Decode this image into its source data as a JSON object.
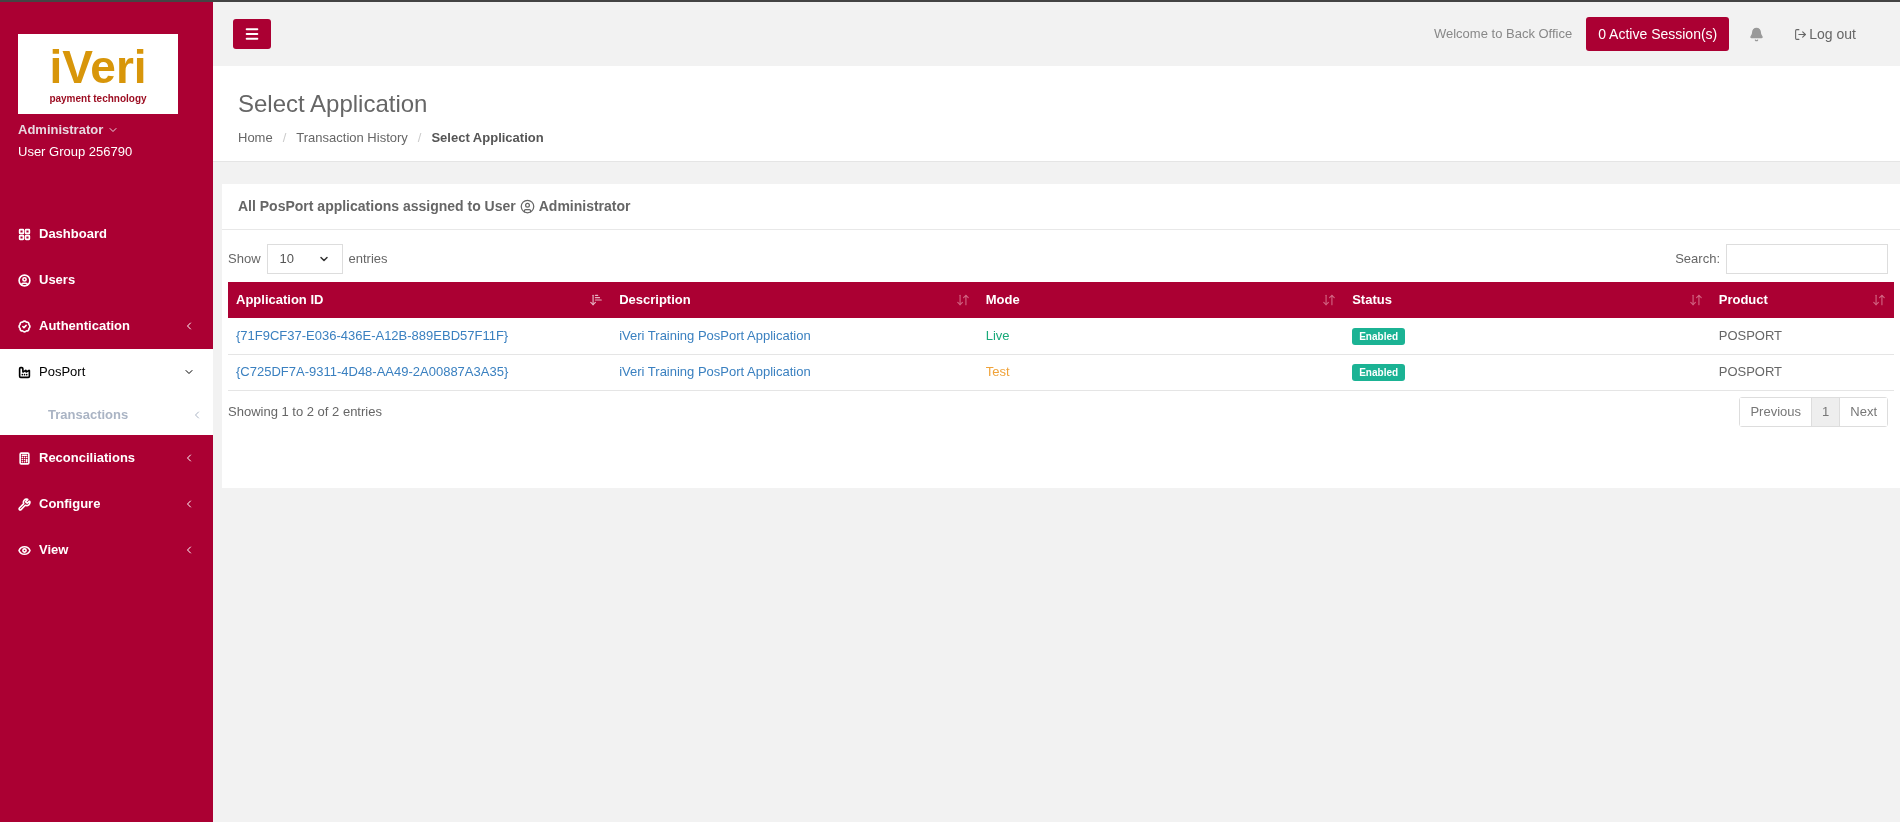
{
  "logo": {
    "brand": "iVeri",
    "tagline": "payment technology"
  },
  "user": {
    "name": "Administrator",
    "group": "User Group 256790"
  },
  "sidebar": {
    "items": [
      {
        "label": "Dashboard",
        "selected": false
      },
      {
        "label": "Users",
        "selected": false
      },
      {
        "label": "Authentication",
        "selected": false,
        "expanded": false
      },
      {
        "label": "PosPort",
        "selected": true,
        "expanded": true,
        "children": [
          {
            "label": "Transactions",
            "expanded": false
          }
        ]
      },
      {
        "label": "Reconciliations",
        "selected": false,
        "expanded": false
      },
      {
        "label": "Configure",
        "selected": false,
        "expanded": false
      },
      {
        "label": "View",
        "selected": false,
        "expanded": false
      }
    ]
  },
  "topbar": {
    "welcome": "Welcome to Back Office",
    "sessions_button": "0 Active Session(s)",
    "logout": "Log out"
  },
  "page": {
    "title": "Select Application",
    "breadcrumb": [
      {
        "label": "Home",
        "current": false
      },
      {
        "separator": "/",
        "label": "Transaction History",
        "current": false
      },
      {
        "separator": "/",
        "label": "Select Application",
        "current": true
      }
    ]
  },
  "card": {
    "title": "All PosPort applications assigned to User",
    "user": "Administrator"
  },
  "table_controls": {
    "show_label": "Show",
    "page_size": "10",
    "entries_label": "entries",
    "search_label": "Search:"
  },
  "table": {
    "columns": [
      {
        "label": "Application ID",
        "sorted": true
      },
      {
        "label": "Description",
        "sorted": false
      },
      {
        "label": "Mode",
        "sorted": false
      },
      {
        "label": "Status",
        "sorted": false
      },
      {
        "label": "Product",
        "sorted": false
      }
    ],
    "rows": [
      {
        "application_id": "{71F9CF37-E036-436E-A12B-889EBD57F11F}",
        "description": "iVeri Training PosPort Application",
        "mode": "Live",
        "color": "#1aaa7a",
        "status": "Enabled",
        "product": "POSPORT"
      },
      {
        "application_id": "{C725DF7A-9311-4D48-AA49-2A00887A3A35}",
        "description": "iVeri Training PosPort Application",
        "mode": "Test",
        "color": "#f0a33a",
        "status": "Enabled",
        "product": "POSPORT"
      }
    ]
  },
  "footer": {
    "info": "Showing 1 to 2 of 2 entries",
    "pagination": [
      {
        "label": "Previous",
        "selected": false
      },
      {
        "label": "1",
        "selected": true
      },
      {
        "label": "Next",
        "selected": false
      }
    ]
  }
}
